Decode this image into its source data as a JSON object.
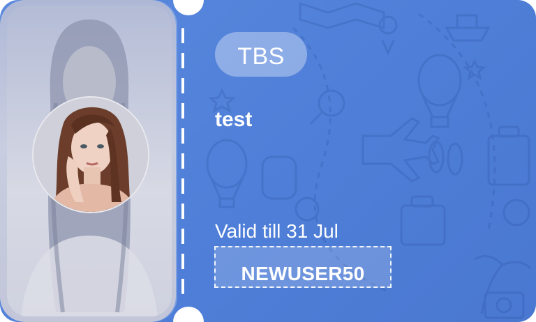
{
  "ticket": {
    "brand": "TBS",
    "title": "test",
    "validity": "Valid till 31 Jul",
    "coupon_code": "NEWUSER50"
  },
  "icons": {
    "background_pattern": "travel-pattern-icon",
    "avatar": "user-photo-icon"
  },
  "colors": {
    "ticket_blue": "#4f7fd8",
    "text": "#ffffff",
    "photo_panel": "#c8cde0"
  }
}
